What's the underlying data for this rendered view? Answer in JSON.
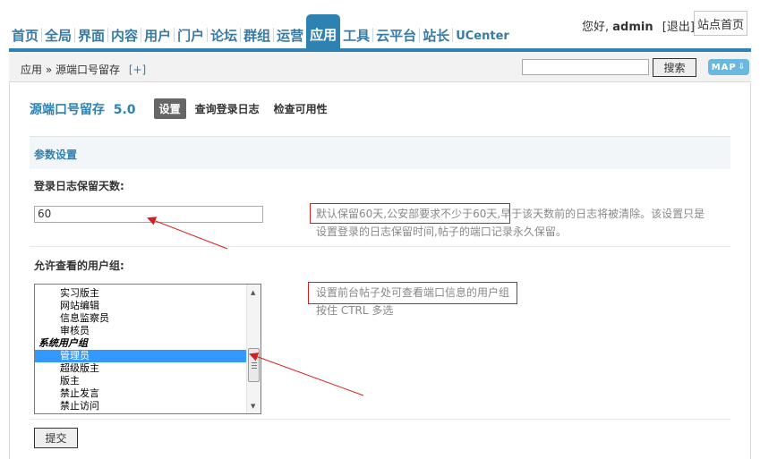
{
  "nav": {
    "items": [
      {
        "label": "首页"
      },
      {
        "label": "全局"
      },
      {
        "label": "界面"
      },
      {
        "label": "内容"
      },
      {
        "label": "用户"
      },
      {
        "label": "门户"
      },
      {
        "label": "论坛"
      },
      {
        "label": "群组"
      },
      {
        "label": "运营"
      },
      {
        "label": "应用"
      },
      {
        "label": "工具"
      },
      {
        "label": "云平台"
      },
      {
        "label": "站长"
      },
      {
        "label": "UCenter"
      }
    ],
    "active_index": 9
  },
  "user": {
    "greeting": "您好,",
    "name": "admin",
    "logout": "[退出]",
    "site_home": "站点首页"
  },
  "breadcrumb": {
    "text": "应用 » 源端口号留存",
    "add": "[+]"
  },
  "search": {
    "value": "",
    "button": "搜索",
    "map_button": "MAP"
  },
  "plugin": {
    "title": "源端口号留存",
    "version": "5.0",
    "tabs": [
      "设置",
      "查询登录日志",
      "检查可用性"
    ]
  },
  "section": {
    "title": "参数设置"
  },
  "fields": {
    "log_days": {
      "label": "登录日志保留天数:",
      "value": "60",
      "tip_line1_highlight": "默认保留60天,公安部要求不少于60天",
      "tip_line1_rest": ",早于该天数前的日志将被清除。该设置只是",
      "tip_line2": "设置登录的日志保留时间,帖子的端口记录永久保留。"
    },
    "user_groups": {
      "label": "允许查看的用户组:",
      "options": [
        {
          "label": "实习版主",
          "type": "option"
        },
        {
          "label": "网站编辑",
          "type": "option"
        },
        {
          "label": "信息监察员",
          "type": "option"
        },
        {
          "label": "审核员",
          "type": "option"
        },
        {
          "label": "系统用户组",
          "type": "group"
        },
        {
          "label": "管理员",
          "type": "option",
          "selected": true
        },
        {
          "label": "超级版主",
          "type": "option"
        },
        {
          "label": "版主",
          "type": "option"
        },
        {
          "label": "禁止发言",
          "type": "option"
        },
        {
          "label": "禁止访问",
          "type": "option"
        }
      ],
      "tip_highlight": "设置前台帖子处可查看端口信息的用户组",
      "tip_line2": "按住 CTRL 多选"
    }
  },
  "submit": {
    "label": "提交"
  },
  "colors": {
    "accent": "#2d82b1",
    "highlight_box": "#d51f1f",
    "selected_option": "#3399ff"
  }
}
